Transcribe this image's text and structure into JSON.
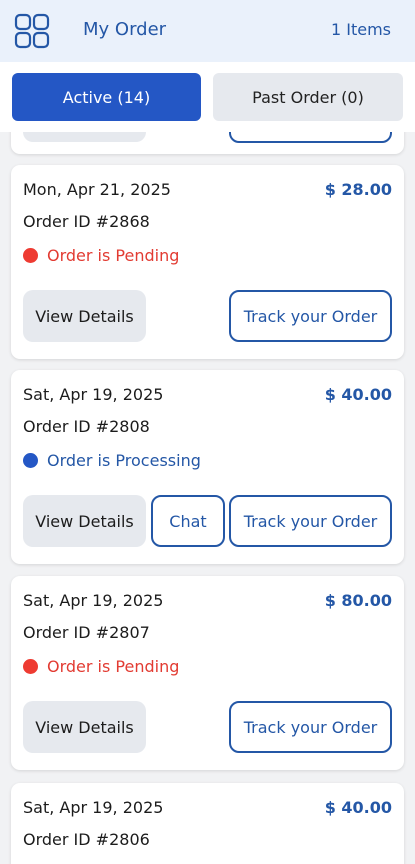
{
  "header": {
    "title": "My Order",
    "items_count": "1 Items",
    "menu_icon": "grid-icon",
    "accent_color": "#2457a6"
  },
  "tabs": [
    {
      "label": "Active (14)",
      "active": true
    },
    {
      "label": "Past Order (0)",
      "active": false
    }
  ],
  "orders": [
    {
      "date": "Mon, Apr 21, 2025",
      "price": "$ 28.00",
      "order_id": "Order ID #2868",
      "status": "Order is Pending",
      "status_color": "#e23b32",
      "buttons": {
        "details": "View Details",
        "track": "Track your Order"
      }
    },
    {
      "date": "Sat, Apr 19, 2025",
      "price": "$ 40.00",
      "order_id": "Order ID #2808",
      "status": "Order is Processing",
      "status_color": "#2457a6",
      "buttons": {
        "details": "View Details",
        "chat": "Chat",
        "track": "Track your Order"
      }
    },
    {
      "date": "Sat, Apr 19, 2025",
      "price": "$ 80.00",
      "order_id": "Order ID #2807",
      "status": "Order is Pending",
      "status_color": "#e23b32",
      "buttons": {
        "details": "View Details",
        "track": "Track your Order"
      }
    },
    {
      "date": "Sat, Apr 19, 2025",
      "price": "$ 40.00",
      "order_id": "Order ID #2806"
    }
  ]
}
